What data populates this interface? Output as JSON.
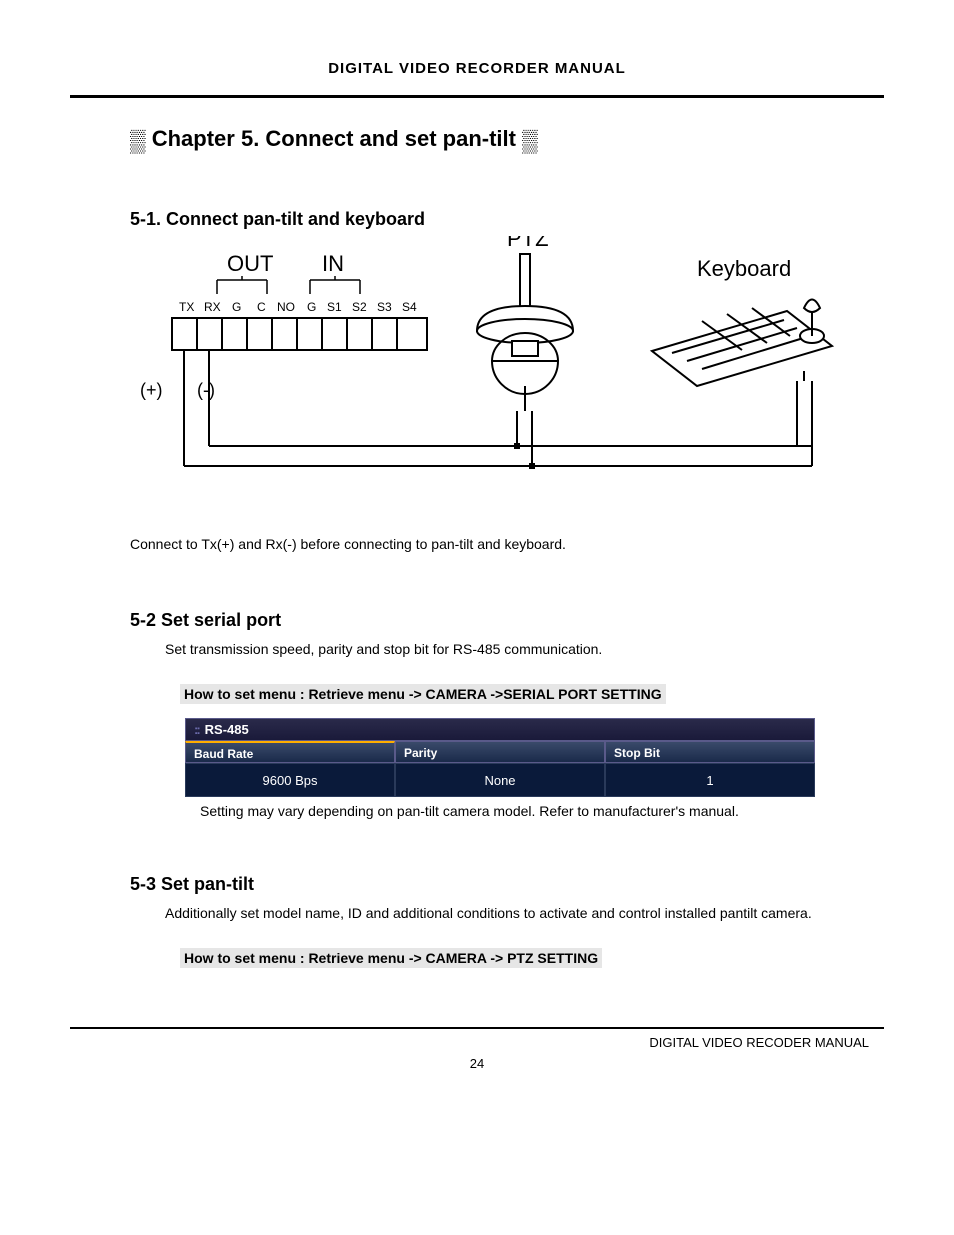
{
  "header_title": "DIGITAL VIDEO RECORDER MANUAL",
  "chapter_title": "Chapter 5. Connect and set pan-tilt",
  "section_5_1": {
    "title": "5-1. Connect pan-tilt and keyboard",
    "diagram": {
      "label_out": "OUT",
      "label_in": "IN",
      "label_ptz": "PTZ",
      "label_keyboard": "Keyboard",
      "terminals": [
        "TX",
        "RX",
        "G",
        "C",
        "NO",
        "G",
        "S1",
        "S2",
        "S3",
        "S4"
      ],
      "plus": "(+)",
      "minus": "(-)"
    },
    "note": "Connect to Tx(+) and Rx(-) before connecting to pan-tilt and keyboard."
  },
  "section_5_2": {
    "title": "5-2 Set serial port",
    "desc": "Set transmission speed, parity and stop bit for RS-485 communication.",
    "menu_path": "How to set menu : Retrieve menu -> CAMERA ->SERIAL PORT SETTING",
    "rs485_label": "RS-485",
    "columns": [
      "Baud Rate",
      "Parity",
      "Stop Bit"
    ],
    "row": [
      "9600 Bps",
      "None",
      "1"
    ],
    "caption": "Setting may vary depending on pan-tilt camera model. Refer to manufacturer's manual."
  },
  "section_5_3": {
    "title": "5-3 Set pan-tilt",
    "desc": "Additionally set model name, ID and additional conditions to activate and control installed pantilt camera.",
    "menu_path": "How to set menu : Retrieve menu -> CAMERA -> PTZ SETTING"
  },
  "footer_text": "DIGITAL VIDEO RECODER MANUAL",
  "page_number": "24"
}
